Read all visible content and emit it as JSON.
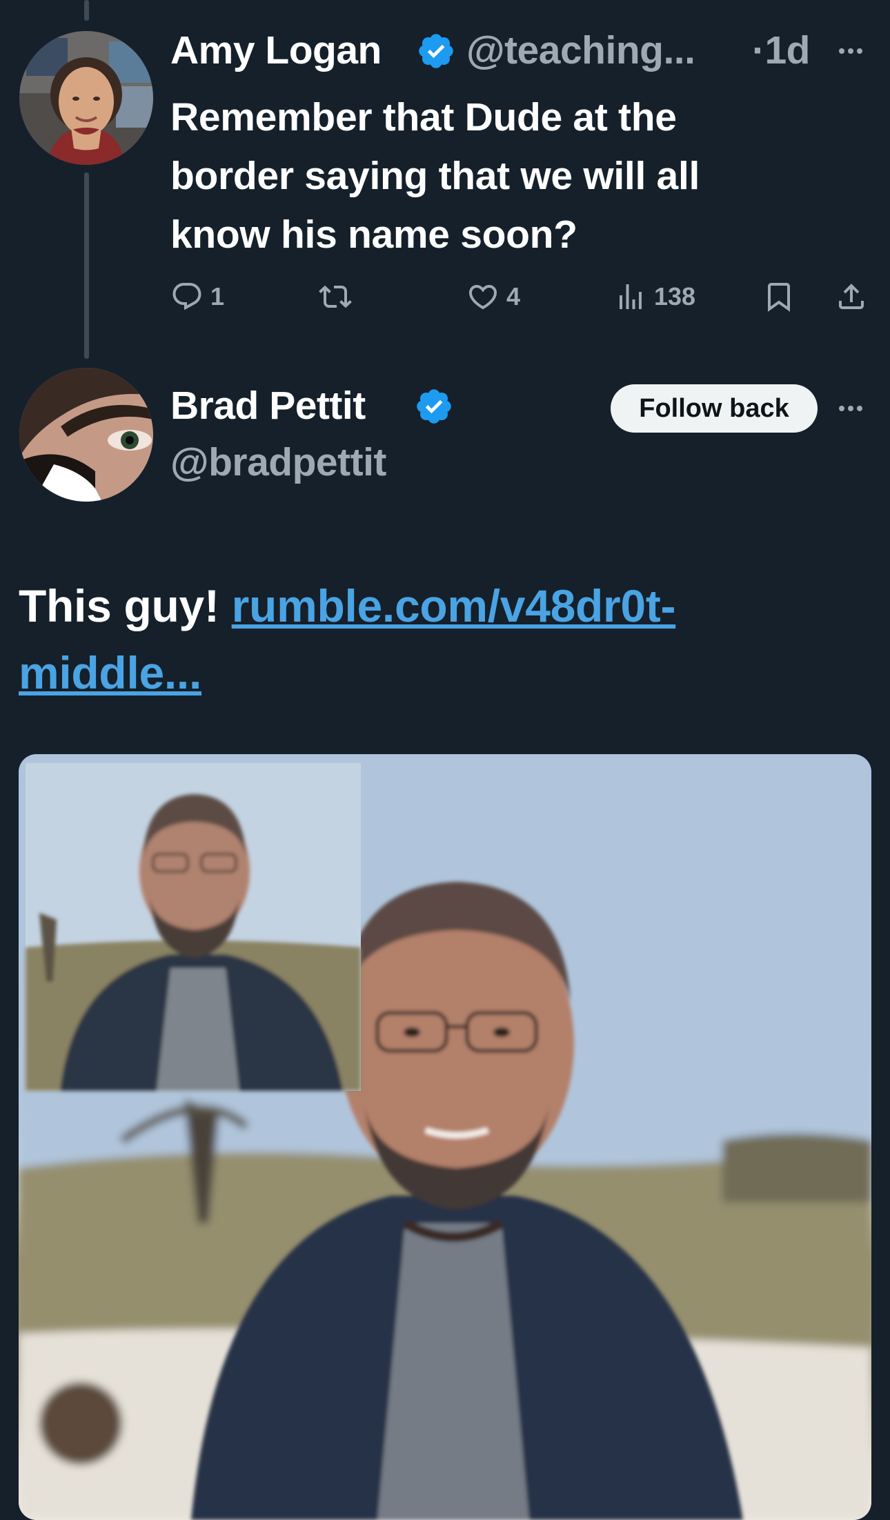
{
  "tweet1": {
    "display_name": "Amy Logan",
    "handle": "@teaching...",
    "time": "·1d",
    "text_lines": [
      "Remember that Dude at the",
      "border saying that we will all",
      "know his name soon?"
    ],
    "counts": {
      "replies": "1",
      "retweets": "",
      "likes": "4",
      "views": "138"
    }
  },
  "tweet2": {
    "display_name": "Brad Pettit",
    "handle": "@bradpettit",
    "follow_label": "Follow back",
    "text": "This guy! ",
    "link_line1": "rumble.com/v48dr0t-",
    "link_line2": "middle..."
  },
  "colors": {
    "background": "#15202b",
    "accent": "#1d9bf0",
    "link": "#4aa3e3",
    "muted": "#9ea9b4"
  },
  "icons": [
    "reply-icon",
    "retweet-icon",
    "like-icon",
    "views-icon",
    "bookmark-icon",
    "share-icon",
    "verified-icon",
    "more-icon"
  ]
}
